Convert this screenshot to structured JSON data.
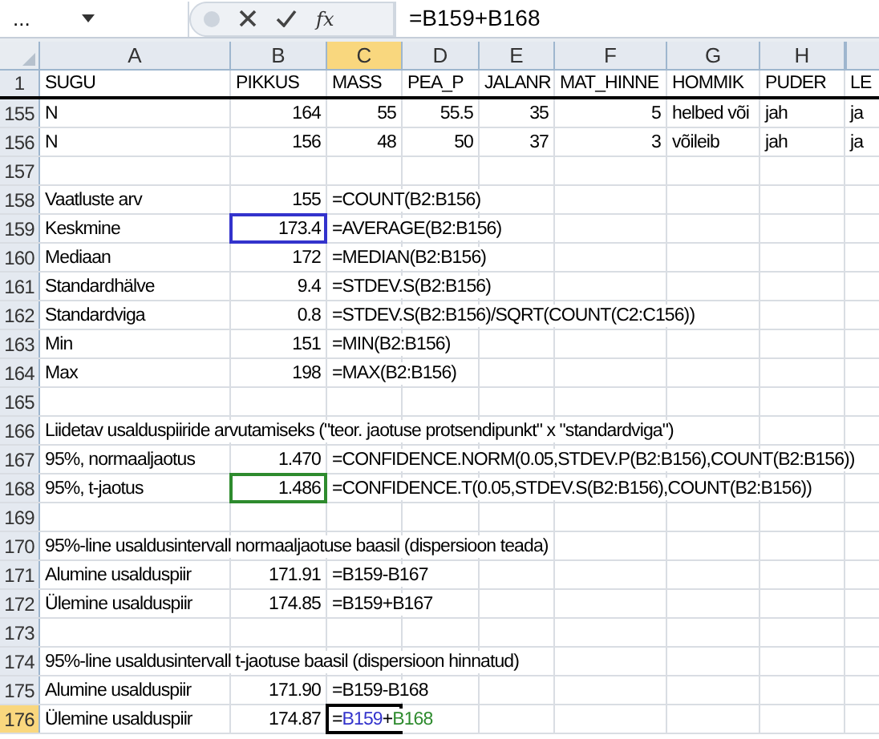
{
  "formula_bar": {
    "name_box": "...",
    "function_button": "fx",
    "formula": "=B159+B168"
  },
  "columns": [
    {
      "label": "A",
      "selected": false
    },
    {
      "label": "B",
      "selected": false
    },
    {
      "label": "C",
      "selected": true
    },
    {
      "label": "D",
      "selected": false
    },
    {
      "label": "E",
      "selected": false
    },
    {
      "label": "F",
      "selected": false
    },
    {
      "label": "G",
      "selected": false
    },
    {
      "label": "H",
      "selected": false
    }
  ],
  "rows": [
    {
      "label": "1",
      "selected": false,
      "header_row": true,
      "cells": [
        {
          "text": "SUGU",
          "kind": "text",
          "selected": false
        },
        {
          "text": "PIKKUS",
          "kind": "text",
          "selected": false
        },
        {
          "text": "MASS",
          "kind": "text",
          "selected": false
        },
        {
          "text": "PEA_P",
          "kind": "text",
          "selected": false
        },
        {
          "text": "JALANR",
          "kind": "text",
          "selected": false
        },
        {
          "text": "MAT_HINNE",
          "kind": "text",
          "selected": false
        },
        {
          "text": "HOMMIK",
          "kind": "text",
          "selected": false
        },
        {
          "text": "PUDER",
          "kind": "text",
          "selected": false
        },
        {
          "text": "LE",
          "kind": "text",
          "selected": false
        }
      ]
    },
    {
      "label": "155",
      "selected": false,
      "cells": [
        {
          "text": "N",
          "kind": "text",
          "selected": false
        },
        {
          "text": "164",
          "kind": "number",
          "selected": false
        },
        {
          "text": "55",
          "kind": "number",
          "selected": false
        },
        {
          "text": "55.5",
          "kind": "number",
          "selected": false
        },
        {
          "text": "35",
          "kind": "number",
          "selected": false
        },
        {
          "text": "5",
          "kind": "number",
          "selected": false
        },
        {
          "text": "helbed või",
          "kind": "text",
          "selected": false
        },
        {
          "text": "jah",
          "kind": "text",
          "selected": false
        },
        {
          "text": "ja",
          "kind": "text",
          "selected": false
        }
      ]
    },
    {
      "label": "156",
      "selected": false,
      "cells": [
        {
          "text": "N",
          "kind": "text",
          "selected": false
        },
        {
          "text": "156",
          "kind": "number",
          "selected": false
        },
        {
          "text": "48",
          "kind": "number",
          "selected": false
        },
        {
          "text": "50",
          "kind": "number",
          "selected": false
        },
        {
          "text": "37",
          "kind": "number",
          "selected": false
        },
        {
          "text": "3",
          "kind": "number",
          "selected": false
        },
        {
          "text": "võileib",
          "kind": "text",
          "selected": false
        },
        {
          "text": "jah",
          "kind": "text",
          "selected": false
        },
        {
          "text": "ja",
          "kind": "text",
          "selected": false
        }
      ]
    },
    {
      "label": "157",
      "selected": false
    },
    {
      "label": "158",
      "selected": false,
      "cells": [
        {
          "text": "Vaatluste arv",
          "kind": "text",
          "selected": false
        },
        {
          "text": "155",
          "kind": "number",
          "selected": false
        },
        {
          "text": "=COUNT(B2:B156)",
          "kind": "text",
          "selected": false
        }
      ]
    },
    {
      "label": "159",
      "selected": false,
      "cells": [
        {
          "text": "Keskmine",
          "kind": "text",
          "selected": false
        },
        {
          "text": "173.4",
          "kind": "number",
          "selected": false,
          "color": "#3333cc"
        },
        {
          "text": "=AVERAGE(B2:B156)",
          "kind": "text",
          "selected": false
        }
      ]
    },
    {
      "label": "160",
      "selected": false,
      "cells": [
        {
          "text": "Mediaan",
          "kind": "text",
          "selected": false
        },
        {
          "text": "172",
          "kind": "number",
          "selected": false
        },
        {
          "text": "=MEDIAN(B2:B156)",
          "kind": "text",
          "selected": false
        }
      ]
    },
    {
      "label": "161",
      "selected": false,
      "cells": [
        {
          "text": "Standardhälve",
          "kind": "text",
          "selected": false
        },
        {
          "text": "9.4",
          "kind": "number",
          "selected": false
        },
        {
          "text": "=STDEV.S(B2:B156)",
          "kind": "text",
          "selected": false
        }
      ]
    },
    {
      "label": "162",
      "selected": false,
      "cells": [
        {
          "text": "Standardviga",
          "kind": "text",
          "selected": false
        },
        {
          "text": "0.8",
          "kind": "number",
          "selected": false
        },
        {
          "text": "=STDEV.S(B2:B156)/SQRT(COUNT(C2:C156))",
          "kind": "text",
          "selected": false
        }
      ]
    },
    {
      "label": "163",
      "selected": false,
      "cells": [
        {
          "text": "Min",
          "kind": "text",
          "selected": false
        },
        {
          "text": "151",
          "kind": "number",
          "selected": false
        },
        {
          "text": "=MIN(B2:B156)",
          "kind": "text",
          "selected": false
        }
      ]
    },
    {
      "label": "164",
      "selected": false,
      "cells": [
        {
          "text": "Max",
          "kind": "text",
          "selected": false
        },
        {
          "text": "198",
          "kind": "number",
          "selected": false
        },
        {
          "text": "=MAX(B2:B156)",
          "kind": "text",
          "selected": false
        }
      ]
    },
    {
      "label": "165",
      "selected": false
    },
    {
      "label": "166",
      "selected": false,
      "cells": [
        {
          "text": "Liidetav usalduspiiride arvutamiseks (\"teor. jaotuse protsendipunkt\" x \"standardviga\")",
          "kind": "text",
          "selected": false
        }
      ]
    },
    {
      "label": "167",
      "selected": false,
      "cells": [
        {
          "text": "95%, normaaljaotus",
          "kind": "text",
          "selected": false
        },
        {
          "text": "1.470",
          "kind": "number",
          "selected": false
        },
        {
          "text": "=CONFIDENCE.NORM(0.05,STDEV.P(B2:B156),COUNT(B2:B156))",
          "kind": "text",
          "selected": false
        }
      ]
    },
    {
      "label": "168",
      "selected": false,
      "cells": [
        {
          "text": "95%, t-jaotus",
          "kind": "text",
          "selected": false
        },
        {
          "text": "1.486",
          "kind": "number",
          "selected": false,
          "color": "#2e8b2e"
        },
        {
          "text": "=CONFIDENCE.T(0.05,STDEV.S(B2:B156),COUNT(B2:B156))",
          "kind": "text",
          "selected": false
        }
      ]
    },
    {
      "label": "169",
      "selected": false
    },
    {
      "label": "170",
      "selected": false,
      "cells": [
        {
          "text": "95%-line usaldusintervall normaaljaotuse baasil (dispersioon teada)",
          "kind": "text",
          "selected": false
        }
      ]
    },
    {
      "label": "171",
      "selected": false,
      "cells": [
        {
          "text": "Alumine usalduspiir",
          "kind": "text",
          "selected": false
        },
        {
          "text": "171.91",
          "kind": "number",
          "selected": false
        },
        {
          "text": "=B159-B167",
          "kind": "text",
          "selected": false
        }
      ]
    },
    {
      "label": "172",
      "selected": false,
      "cells": [
        {
          "text": "Ülemine usalduspiir",
          "kind": "text",
          "selected": false
        },
        {
          "text": "174.85",
          "kind": "number",
          "selected": false
        },
        {
          "text": "=B159+B167",
          "kind": "text",
          "selected": false
        }
      ]
    },
    {
      "label": "173",
      "selected": false
    },
    {
      "label": "174",
      "selected": false,
      "cells": [
        {
          "text": "95%-line usaldusintervall t-jaotuse baasil (dispersioon hinnatud)",
          "kind": "text",
          "selected": false
        }
      ]
    },
    {
      "label": "175",
      "selected": false,
      "cells": [
        {
          "text": "Alumine usalduspiir",
          "kind": "text",
          "selected": false
        },
        {
          "text": "171.90",
          "kind": "number",
          "selected": false
        },
        {
          "text": "=B159-B168",
          "kind": "text",
          "selected": false
        }
      ]
    },
    {
      "label": "176",
      "selected": true,
      "cells": [
        {
          "text": "Ülemine usalduspiir",
          "kind": "text",
          "selected": false
        },
        {
          "text": "174.87",
          "kind": "number",
          "selected": false
        },
        {
          "kind": "formula_edit",
          "selected": true,
          "parts": [
            {
              "text": "="
            },
            {
              "text": "B159",
              "color": "#3333cc"
            },
            {
              "text": "+"
            },
            {
              "text": "B168",
              "color": "#2e8b2e"
            }
          ]
        }
      ]
    }
  ]
}
